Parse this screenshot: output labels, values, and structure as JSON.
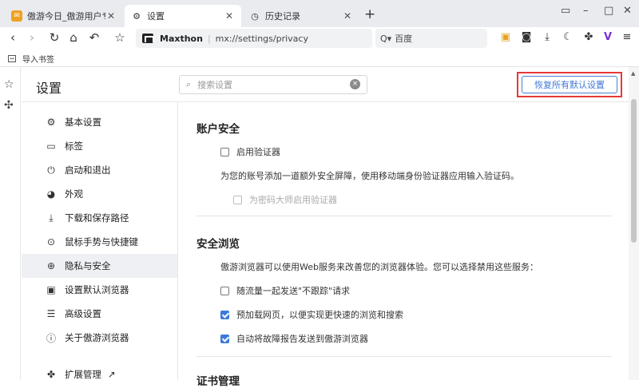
{
  "tabs": [
    {
      "title": "傲游今日_傲游用户专属",
      "icon": "maxthon-today-icon",
      "close": "✕"
    },
    {
      "title": "设置",
      "icon": "gear-icon",
      "close": "✕"
    },
    {
      "title": "历史记录",
      "icon": "clock-icon",
      "close": "✕"
    }
  ],
  "new_tab": "+",
  "window_controls": {
    "panel": "▭",
    "minimize": "–",
    "maximize": "□",
    "close": "✕"
  },
  "navbar": {
    "host": "Maxthon",
    "path": "mx://settings/privacy",
    "search_engine": "百度",
    "search_prefix": "Q▾"
  },
  "bookmarks": {
    "import_label": "导入书签"
  },
  "settings": {
    "title": "设置",
    "search_placeholder": "搜索设置",
    "restore_label": "恢复所有默认设置"
  },
  "nav_items": [
    {
      "label": "基本设置",
      "icon": "gear-icon",
      "glyph": "⚙"
    },
    {
      "label": "标签",
      "icon": "tab-icon",
      "glyph": "▭"
    },
    {
      "label": "启动和退出",
      "icon": "power-icon",
      "glyph": "⏻"
    },
    {
      "label": "外观",
      "icon": "palette-icon",
      "glyph": "◕"
    },
    {
      "label": "下载和保存路径",
      "icon": "download-folder-icon",
      "glyph": "⤓"
    },
    {
      "label": "鼠标手势与快捷键",
      "icon": "mouse-icon",
      "glyph": "⊙"
    },
    {
      "label": "隐私与安全",
      "icon": "lock-icon",
      "glyph": "⊕"
    },
    {
      "label": "设置默认浏览器",
      "icon": "browser-icon",
      "glyph": "▣"
    },
    {
      "label": "高级设置",
      "icon": "sliders-icon",
      "glyph": "☰"
    },
    {
      "label": "关于傲游浏览器",
      "icon": "info-icon",
      "glyph": "ⓘ"
    },
    {
      "label": "扩展管理",
      "icon": "puzzle-icon",
      "glyph": "✤"
    }
  ],
  "content": {
    "account_title": "账户安全",
    "authenticator_label": "启用验证器",
    "authenticator_desc": "为您的账号添加一道额外安全屏障，使用移动端身份验证器应用输入验证码。",
    "password_master_label": "为密码大师启用验证器",
    "safe_title": "安全浏览",
    "safe_desc": "傲游浏览器可以使用Web服务来改善您的浏览器体验。您可以选择禁用这些服务：",
    "dnt_label": "随流量一起发送\"不跟踪\"请求",
    "preload_label": "预加载网页，以便实现更快速的浏览和搜索",
    "crash_label": "自动将故障报告发送到傲游浏览器",
    "cert_title": "证书管理",
    "checks": {
      "authenticator": false,
      "password_master": false,
      "dnt": false,
      "preload": true,
      "crash": true
    }
  }
}
